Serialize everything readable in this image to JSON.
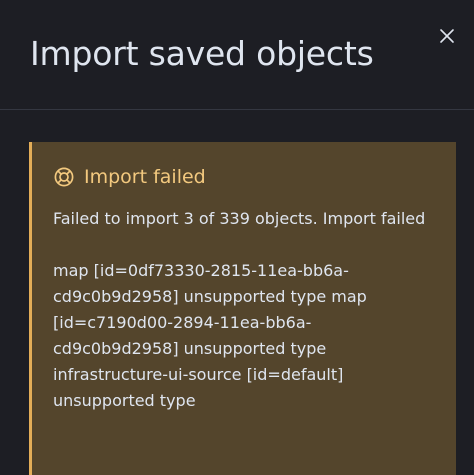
{
  "flyout": {
    "title": "Import saved objects",
    "close_icon": "close-icon"
  },
  "callout": {
    "icon": "help-icon",
    "color": "#e3ad58",
    "title": "Import failed",
    "summary": "Failed to import 3 of 339 objects. Import failed",
    "details": "map [id=0df73330-2815-11ea-bb6a-cd9c0b9d2958] unsupported type map [id=c7190d00-2894-11ea-bb6a-cd9c0b9d2958] unsupported type infrastructure-ui-source [id=default] unsupported type"
  }
}
